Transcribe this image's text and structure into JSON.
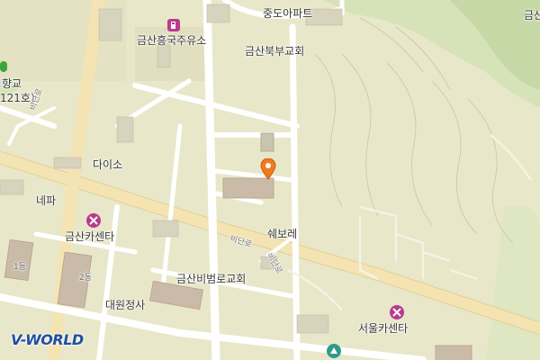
{
  "map": {
    "labels": {
      "jungdo_apt": "중도아파트",
      "gas_station": "금산흥국주유소",
      "church_north": "금산북부교회",
      "school_partial": "향교",
      "school_no_partial": "121호)",
      "daiso": "다이소",
      "nepa": "네파",
      "car_center": "금산카센타",
      "shwebore": "쉐보레",
      "bibeomro_church": "금산비범로교회",
      "daewon": "대원정사",
      "seoul_car_center": "서울카센타",
      "bldg_1": "1동",
      "bldg_2": "2동",
      "top_right_partial": "금산"
    },
    "roads": {
      "road_a": "비단로",
      "road_b": "비단로",
      "road_c": "비단로"
    },
    "logo_text": "V-WORLD",
    "colors": {
      "land": "#e8e7c9",
      "green": "#d3e0b4",
      "dark_green": "#bcd3a2",
      "road": "#ffffff",
      "major_road": "#f5e6b8",
      "building": "#c9b8a6",
      "poi_purple": "#b93b8c",
      "pin_orange": "#f07b1e",
      "water": "#cfe3ea"
    },
    "icons": [
      "fuel-icon",
      "repair-icon",
      "park-icon",
      "location-pin-icon"
    ]
  }
}
